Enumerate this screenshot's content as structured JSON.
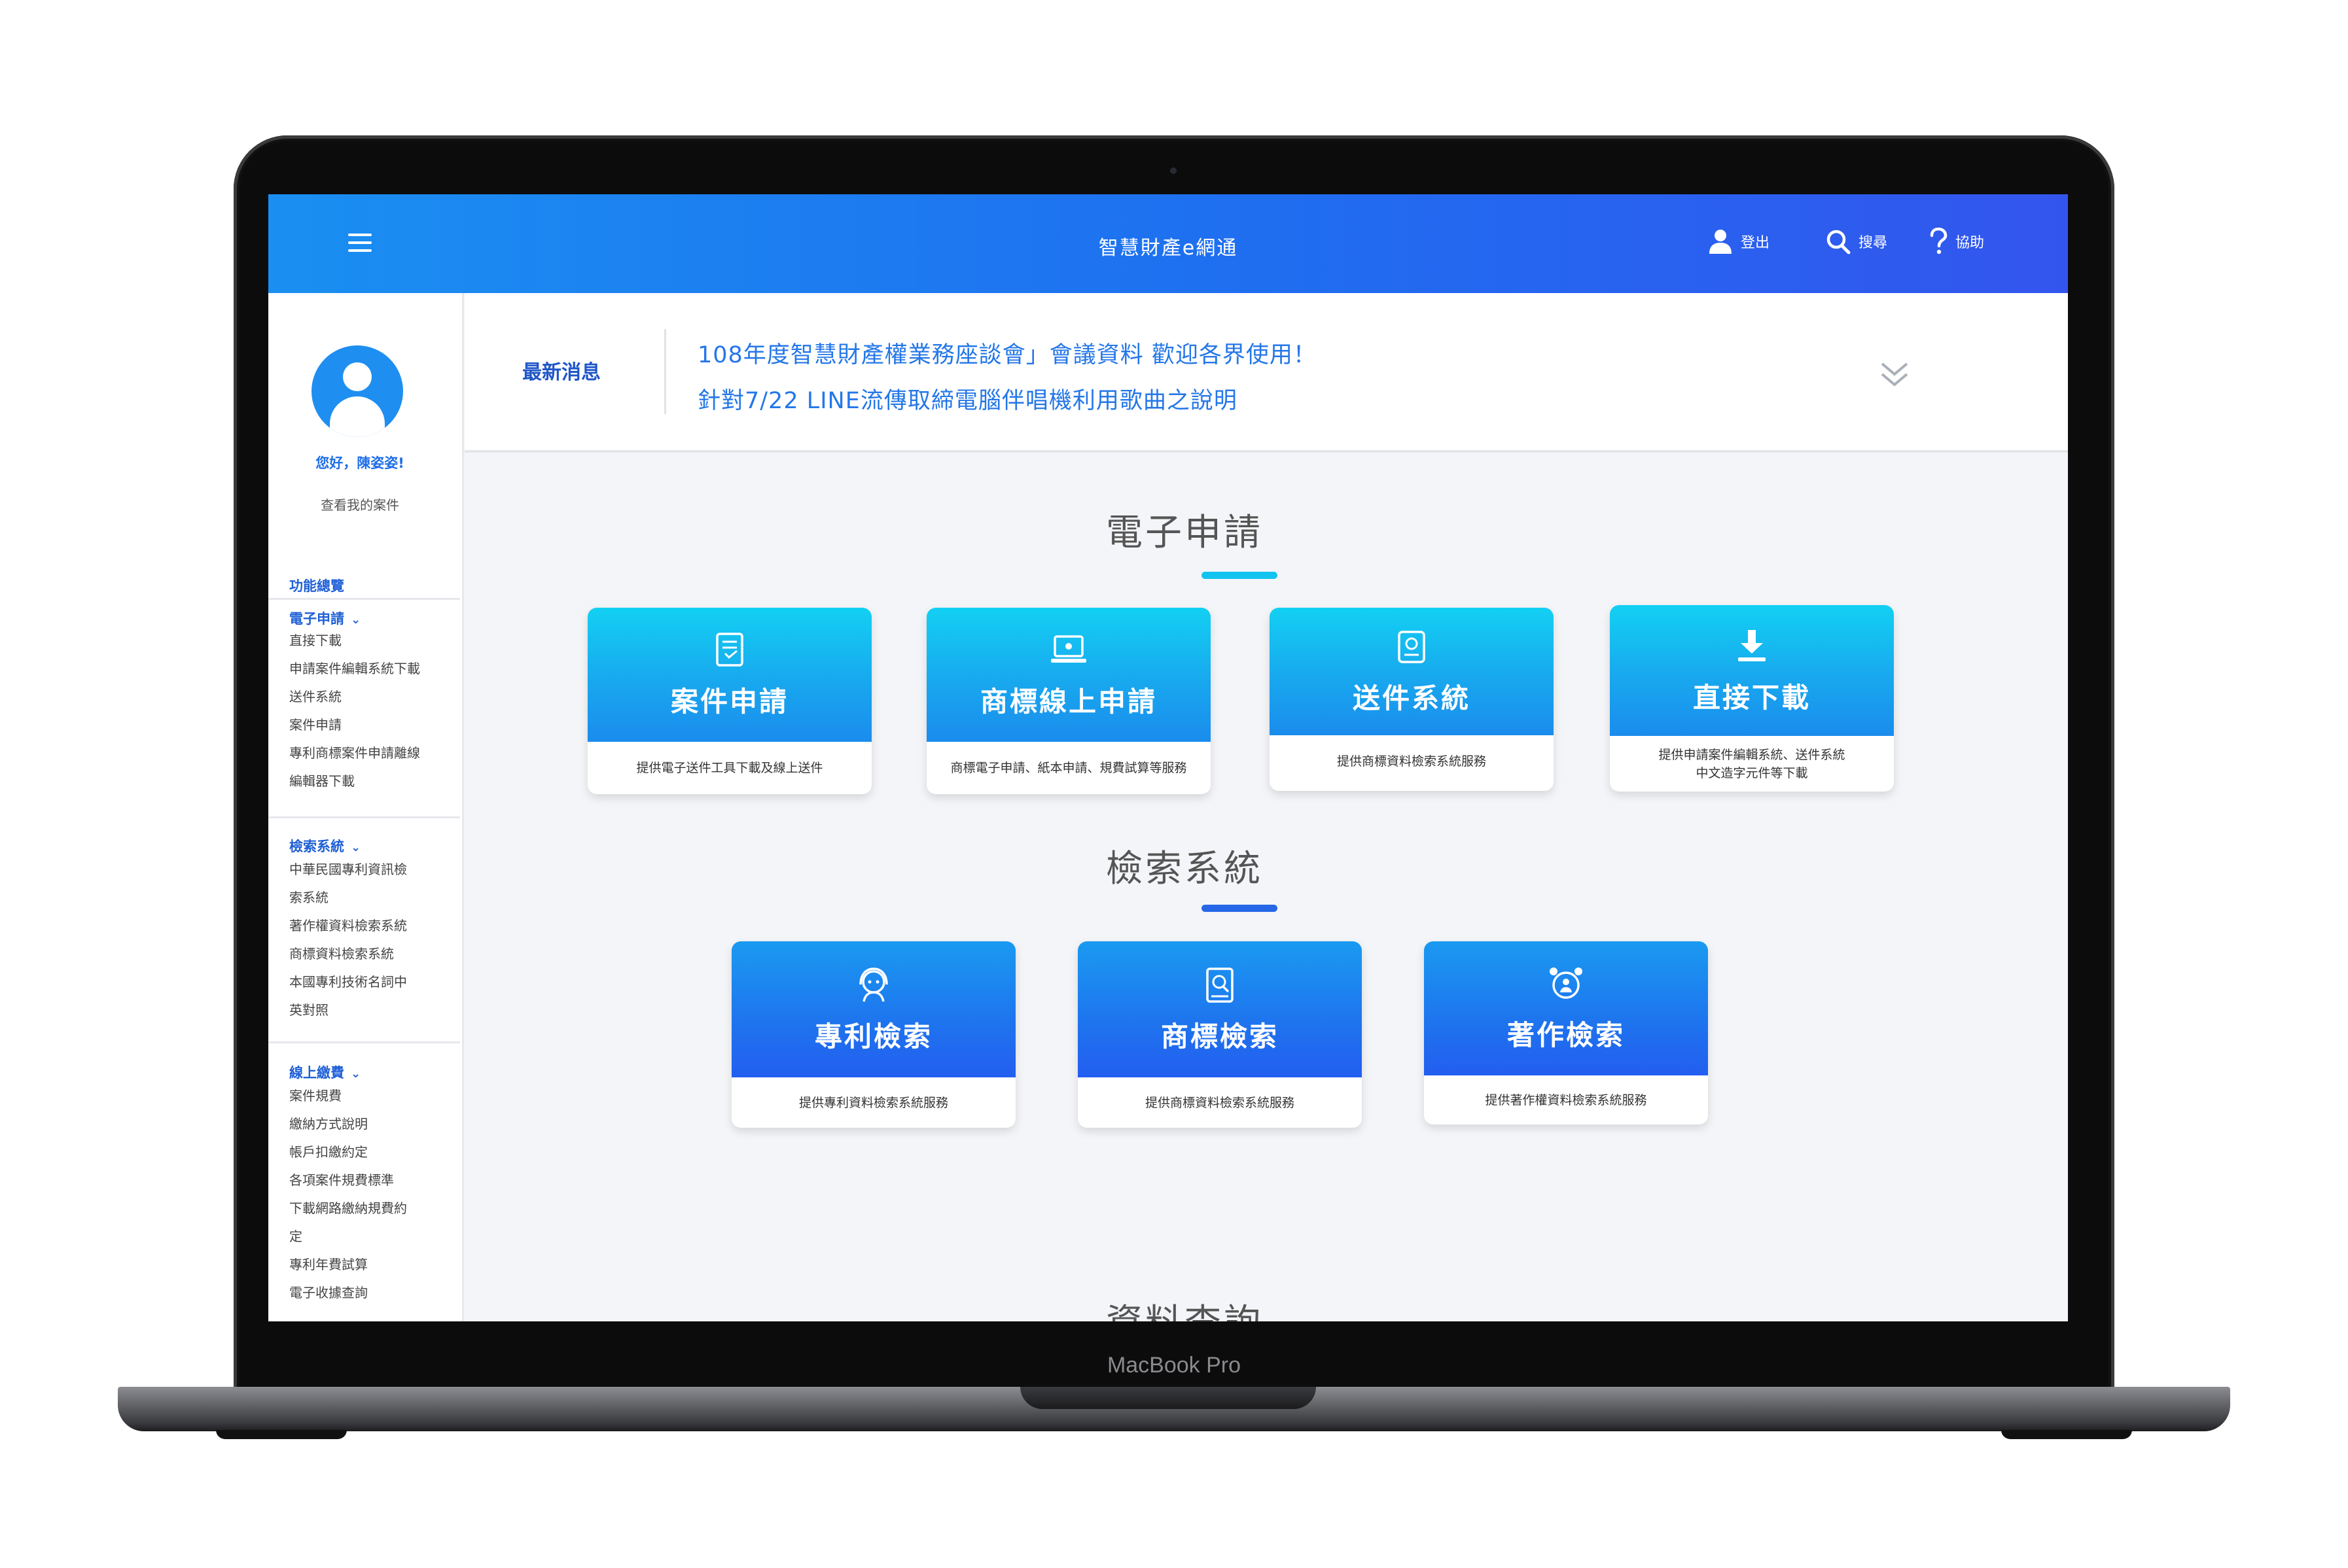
{
  "device": {
    "label": "MacBook Pro"
  },
  "topbar": {
    "app_title": "智慧財產e網通",
    "logout_label": "登出",
    "search_label": "搜尋",
    "help_label": "協助"
  },
  "user": {
    "greeting": "您好，陳姿姿!",
    "my_cases": "查看我的案件"
  },
  "sidebar": {
    "overview_title": "功能總覽",
    "sections": [
      {
        "title": "電子申請",
        "items": [
          "直接下載",
          "申請案件編輯系統下載",
          "送件系統",
          "案件申請",
          "專利商標案件申請離線",
          "編輯器下載"
        ]
      },
      {
        "title": "檢索系統",
        "items": [
          "中華民國專利資訊檢",
          "索系統",
          "著作權資料檢索系統",
          "商標資料檢索系統",
          "本國專利技術名詞中",
          "英對照"
        ]
      },
      {
        "title": "線上繳費",
        "items": [
          "案件規費",
          "繳納方式說明",
          "帳戶扣繳約定",
          "各項案件規費標準",
          "下載網路繳納規費約",
          "定",
          "專利年費試算",
          "電子收據查詢"
        ]
      }
    ]
  },
  "news": {
    "label": "最新消息",
    "items": [
      "108年度智慧財產權業務座談會」會議資料 歡迎各界使用！",
      "針對7/22 LINE流傳取締電腦伴唱機利用歌曲之說明"
    ]
  },
  "sections": {
    "eapply": {
      "heading": "電子申請",
      "accent": "#12c3ef",
      "cards": [
        {
          "title": "案件申請",
          "desc": "提供電子送件工具下載及線上送件",
          "icon": "document-form-icon"
        },
        {
          "title": "商標線上申請",
          "desc": "商標電子申請、紙本申請、規費試算等服務",
          "icon": "laptop-icon"
        },
        {
          "title": "送件系統",
          "desc": "提供商標資料檢索系統服務",
          "icon": "id-card-icon"
        },
        {
          "title": "直接下載",
          "desc": "提供申請案件編輯系統、送件系統中文造字元件等下載",
          "icon": "download-icon"
        }
      ]
    },
    "search": {
      "heading": "檢索系統",
      "accent": "#2567e6",
      "cards": [
        {
          "title": "專利檢索",
          "desc": "提供專利資料檢索系統服務",
          "icon": "agent-headset-icon"
        },
        {
          "title": "商標檢索",
          "desc": "提供商標資料檢索系統服務",
          "icon": "document-search-icon"
        },
        {
          "title": "著作檢索",
          "desc": "提供著作權資料檢索系統服務",
          "icon": "alarm-person-icon"
        }
      ]
    },
    "data_query": {
      "heading": "資料查詢"
    }
  }
}
